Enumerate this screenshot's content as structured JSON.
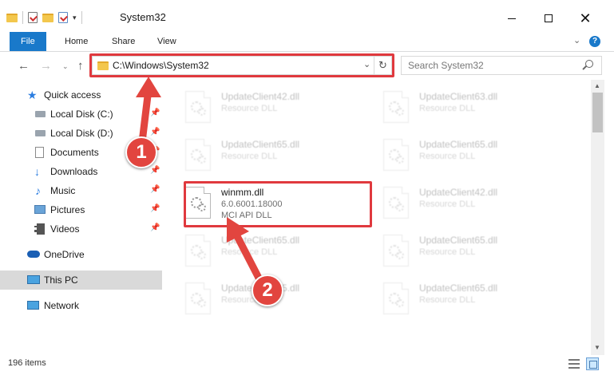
{
  "window": {
    "title": "System32"
  },
  "ribbon": {
    "tabs": [
      "File",
      "Home",
      "Share",
      "View"
    ],
    "help_icon": "?"
  },
  "nav": {
    "address": "C:\\Windows\\System32",
    "search_placeholder": "Search System32"
  },
  "sidebar": {
    "items": [
      {
        "label": "Quick access",
        "icon": "star-icon",
        "pinned": false
      },
      {
        "label": "Local Disk (C:)",
        "icon": "drive-icon",
        "pinned": true
      },
      {
        "label": "Local Disk (D:)",
        "icon": "drive-icon",
        "pinned": true
      },
      {
        "label": "Documents",
        "icon": "documents-icon",
        "pinned": true
      },
      {
        "label": "Downloads",
        "icon": "download-icon",
        "pinned": true
      },
      {
        "label": "Music",
        "icon": "music-icon",
        "pinned": true
      },
      {
        "label": "Pictures",
        "icon": "pictures-icon",
        "pinned": true
      },
      {
        "label": "Videos",
        "icon": "videos-icon",
        "pinned": true
      },
      {
        "label": "OneDrive",
        "icon": "cloud-icon",
        "pinned": false
      },
      {
        "label": "This PC",
        "icon": "computer-icon",
        "pinned": false,
        "selected": true
      },
      {
        "label": "Network",
        "icon": "network-icon",
        "pinned": false
      }
    ]
  },
  "files": [
    {
      "name": "UpdateClient42.dll",
      "type": "Resource DLL",
      "faded": true
    },
    {
      "name": "UpdateClient63.dll",
      "type": "Resource DLL",
      "faded": true
    },
    {
      "name": "UpdateClient65.dll",
      "type": "Resource DLL",
      "faded": true
    },
    {
      "name": "UpdateClient65.dll",
      "type": "Resource DLL",
      "faded": true
    },
    {
      "name": "winmm.dll",
      "version": "6.0.6001.18000",
      "type": "MCI API DLL",
      "faded": false
    },
    {
      "name": "UpdateClient42.dll",
      "type": "Resource DLL",
      "faded": true
    },
    {
      "name": "UpdateClient65.dll",
      "type": "Resource DLL",
      "faded": true
    },
    {
      "name": "UpdateClient65.dll",
      "type": "Resource DLL",
      "faded": true
    },
    {
      "name": "UpdateClient65.dll",
      "type": "Resource DLL",
      "faded": true
    },
    {
      "name": "UpdateClient65.dll",
      "type": "Resource DLL",
      "faded": true
    }
  ],
  "status": {
    "item_count": "196 items"
  },
  "annotations": {
    "step1": "1",
    "step2": "2",
    "highlight_color": "#e0393e",
    "badge_color": "#e2453f"
  },
  "colors": {
    "accent": "#1979ca",
    "selected_nav": "#d9d9d9"
  }
}
